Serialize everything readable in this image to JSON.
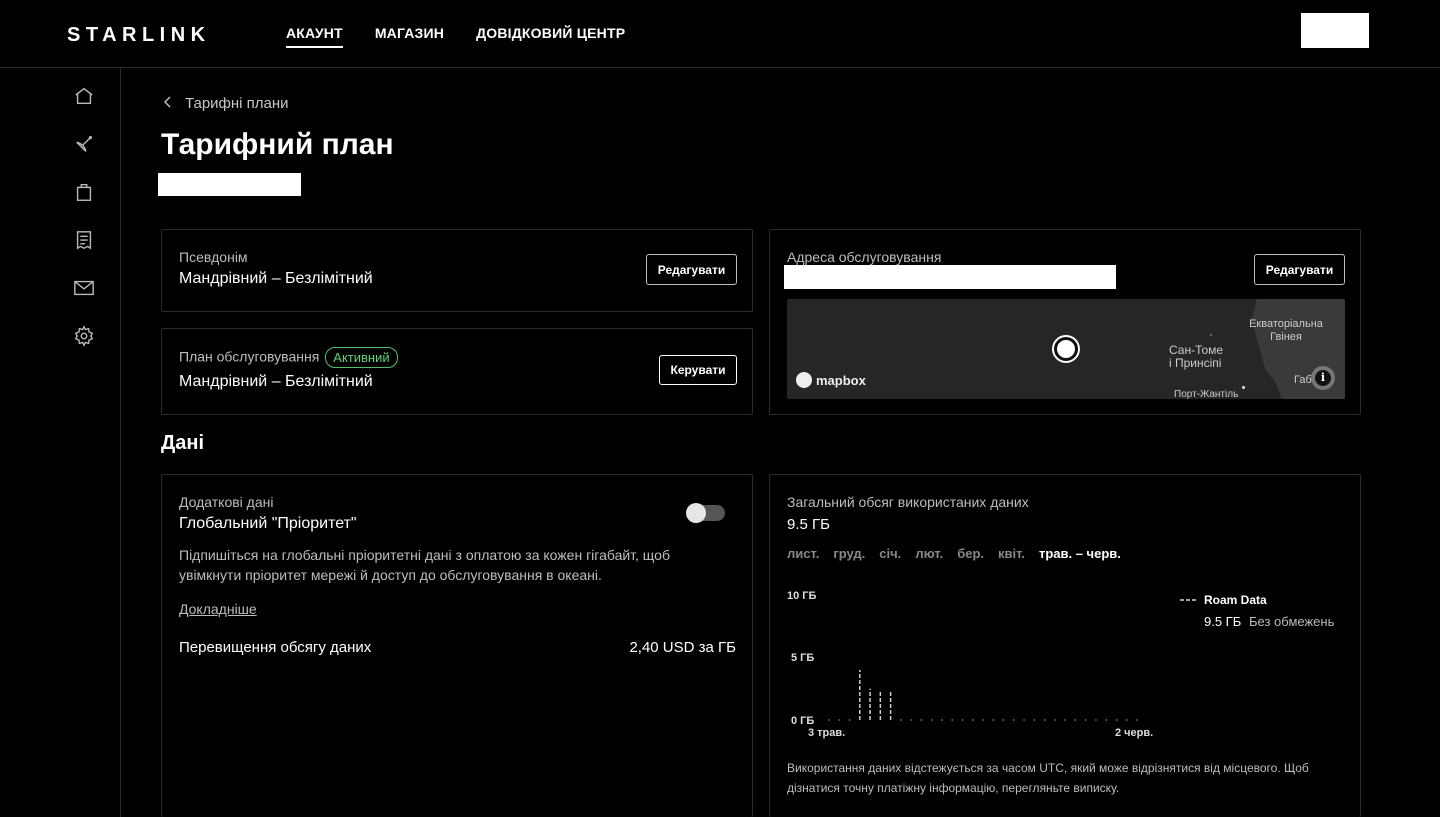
{
  "header": {
    "logo": "STARLINK",
    "nav": [
      "АКАУНТ",
      "МАГАЗИН",
      "ДОВІДКОВИЙ ЦЕНТР"
    ]
  },
  "sidebar": {
    "icons": [
      "home-icon",
      "satellite-icon",
      "shopping-bag-icon",
      "receipt-icon",
      "mail-icon",
      "gear-icon"
    ]
  },
  "breadcrumb": {
    "label": "Тарифні плани"
  },
  "page": {
    "title": "Тарифний план"
  },
  "nickname_card": {
    "label": "Псевдонім",
    "value": "Мандрівний – Безлімітний",
    "button": "Редагувати"
  },
  "plan_card": {
    "label": "План обслуговування",
    "badge": "Активний",
    "value": "Мандрівний – Безлімітний",
    "button": "Керувати"
  },
  "address_card": {
    "label": "Адреса обслуговування",
    "button": "Редагувати",
    "map": {
      "brand": "mapbox",
      "place1": "Екваторіальна Гвінея",
      "place1_line1": "Екваторіальна",
      "place1_line2": "Гвінея",
      "place2_line1": "Сан-Томе",
      "place2_line2": "і Принсіпі",
      "place3": "Порт-Жантіль",
      "place4": "Габ"
    }
  },
  "data_section": {
    "title": "Дані"
  },
  "extra_data_card": {
    "label": "Додаткові дані",
    "title": "Глобальний \"Пріоритет\"",
    "description": "Підпишіться на глобальні пріоритетні дані з оплатою за кожен гігабайт, щоб увімкнути пріоритет мережі й доступ до обслуговування в океані.",
    "link": "Докладніше",
    "toggle_on": false,
    "overage_label": "Перевищення обсягу даних",
    "overage_value": "2,40 USD за ГБ"
  },
  "usage_card": {
    "label": "Загальний обсяг використаних даних",
    "total": "9.5 ГБ",
    "months": [
      "лист.",
      "груд.",
      "січ.",
      "лют.",
      "бер.",
      "квіт.",
      "трав. – черв."
    ],
    "legend_name": "Roam Data",
    "legend_value": "9.5 ГБ",
    "legend_limit": "Без обмежень",
    "note": "Використання даних відстежується за часом UTC, який може відрізнятися від місцевого. Щоб дізнатися точну платіжну інформацію, перегляньте виписку."
  },
  "chart_data": {
    "type": "bar",
    "y_ticks": [
      "10 ГБ",
      "5 ГБ",
      "0 ГБ"
    ],
    "ylim": [
      0,
      10
    ],
    "x_labels": [
      "3 трав.",
      "2 черв."
    ],
    "series": [
      {
        "name": "Roam Data",
        "values": [
          0,
          0,
          0,
          4.0,
          2.5,
          2.4,
          2.4,
          0,
          0,
          0,
          0,
          0,
          0,
          0,
          0,
          0,
          0,
          0,
          0,
          0,
          0,
          0,
          0,
          0,
          0,
          0,
          0,
          0,
          0,
          0,
          0
        ]
      }
    ]
  }
}
